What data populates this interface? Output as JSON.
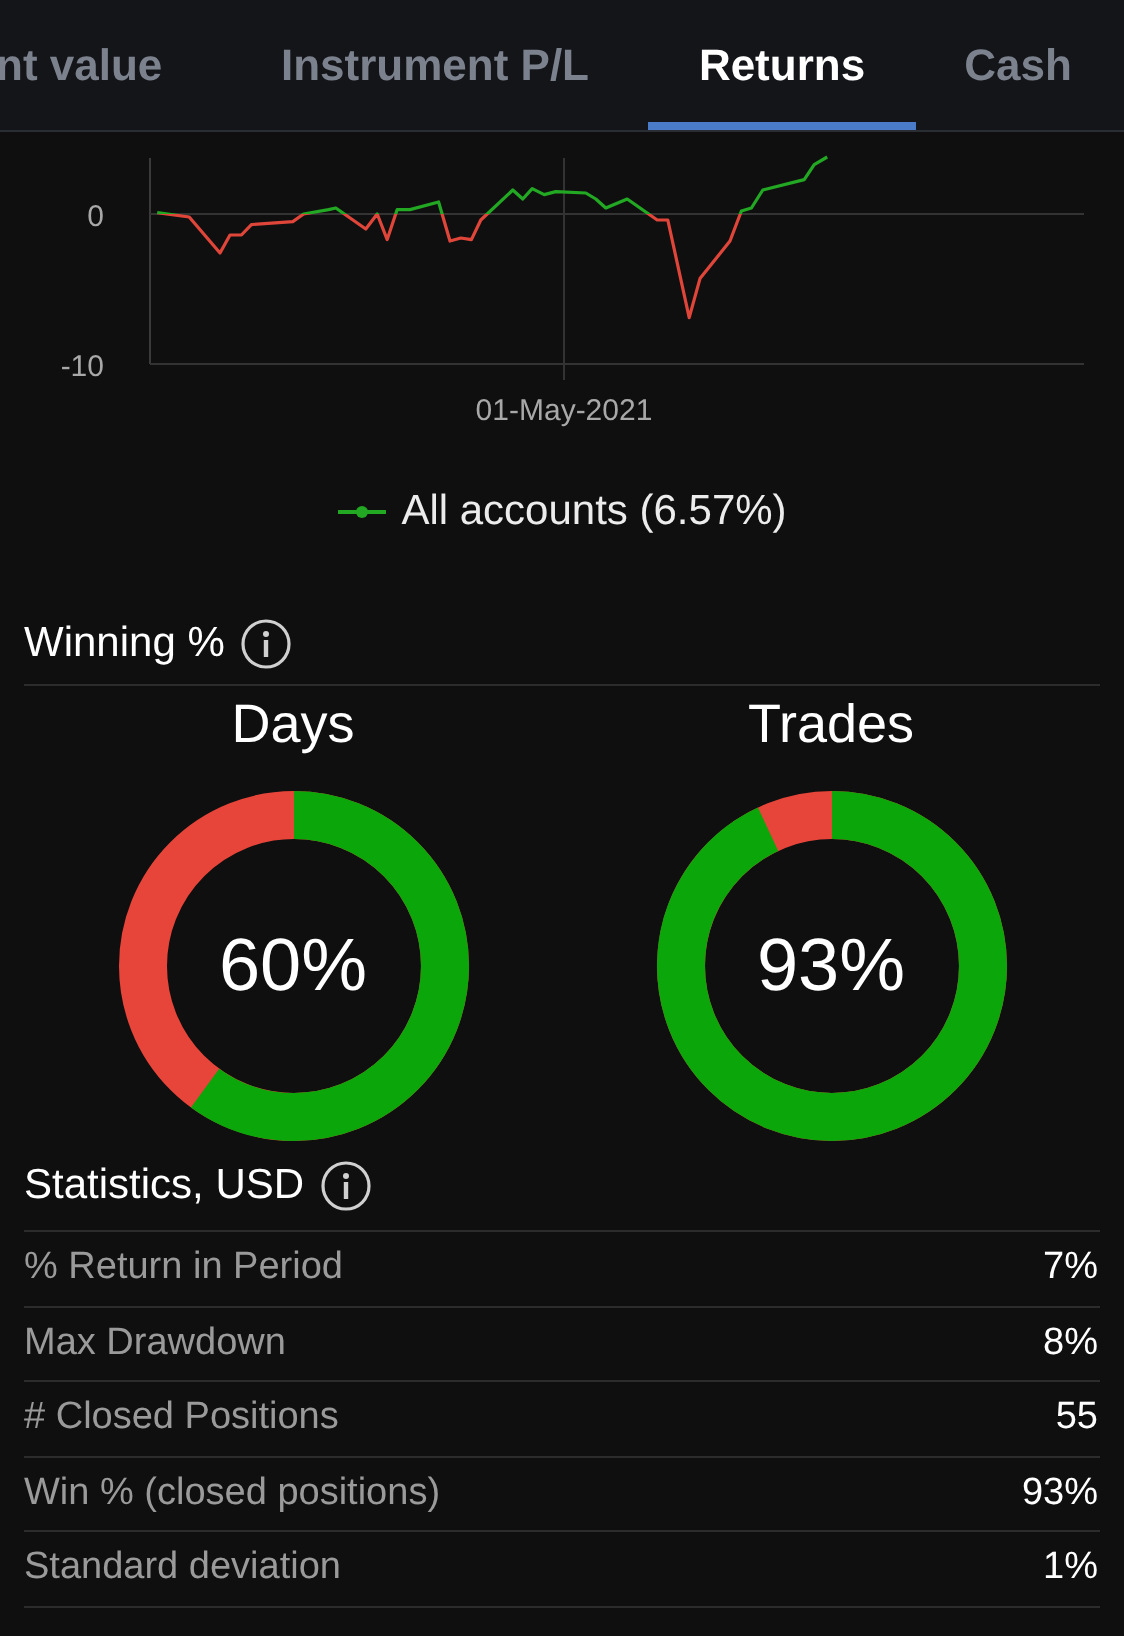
{
  "tabs": [
    {
      "label": "nt value",
      "selected": false
    },
    {
      "label": "Instrument P/L",
      "selected": false
    },
    {
      "label": "Returns",
      "selected": true
    },
    {
      "label": "Cash",
      "selected": false
    }
  ],
  "returns_chart": {
    "y_axis_labels": [
      "0",
      "-10"
    ],
    "x_axis_label": "01-May-2021",
    "legend": "All accounts (6.57%)"
  },
  "winning": {
    "title": "Winning %",
    "gauges": [
      {
        "label": "Days",
        "value": "60%"
      },
      {
        "label": "Trades",
        "value": "93%"
      }
    ]
  },
  "statistics": {
    "title": "Statistics, USD",
    "rows": [
      {
        "label": "% Return in Period",
        "value": "7%"
      },
      {
        "label": "Max Drawdown",
        "value": "8%"
      },
      {
        "label": "# Closed Positions",
        "value": "55"
      },
      {
        "label": "Win % (closed positions)",
        "value": "93%"
      },
      {
        "label": "Standard deviation",
        "value": "1%"
      }
    ]
  }
}
